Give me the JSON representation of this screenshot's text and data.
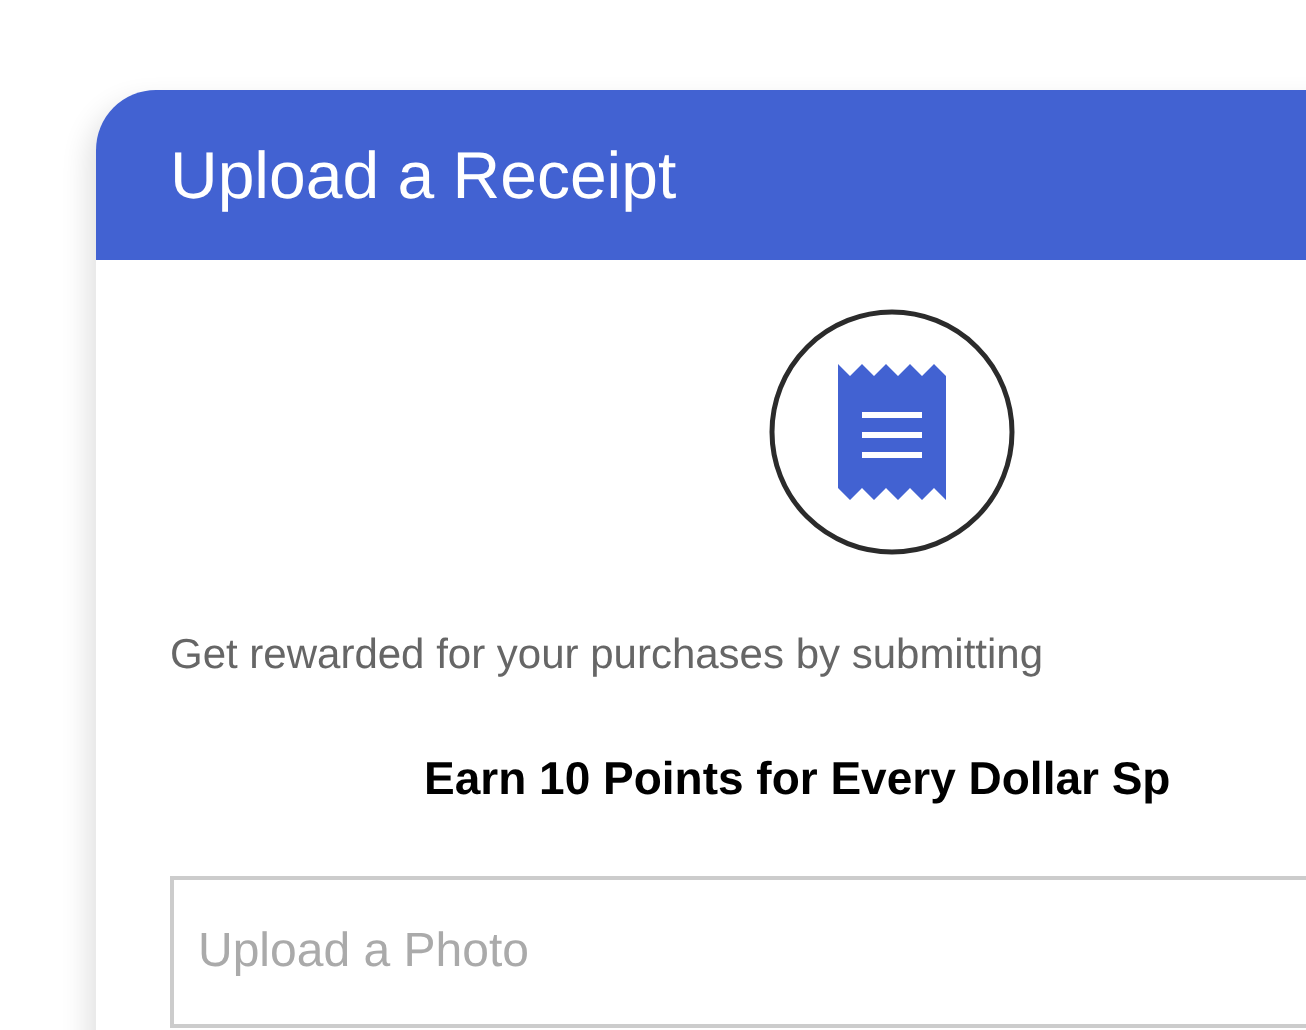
{
  "card": {
    "title": "Upload a Receipt",
    "description": "Get rewarded for your purchases by submitting",
    "offer": "Earn 10 Points for Every Dollar Sp",
    "upload_field": {
      "placeholder": "Upload a Photo"
    }
  }
}
